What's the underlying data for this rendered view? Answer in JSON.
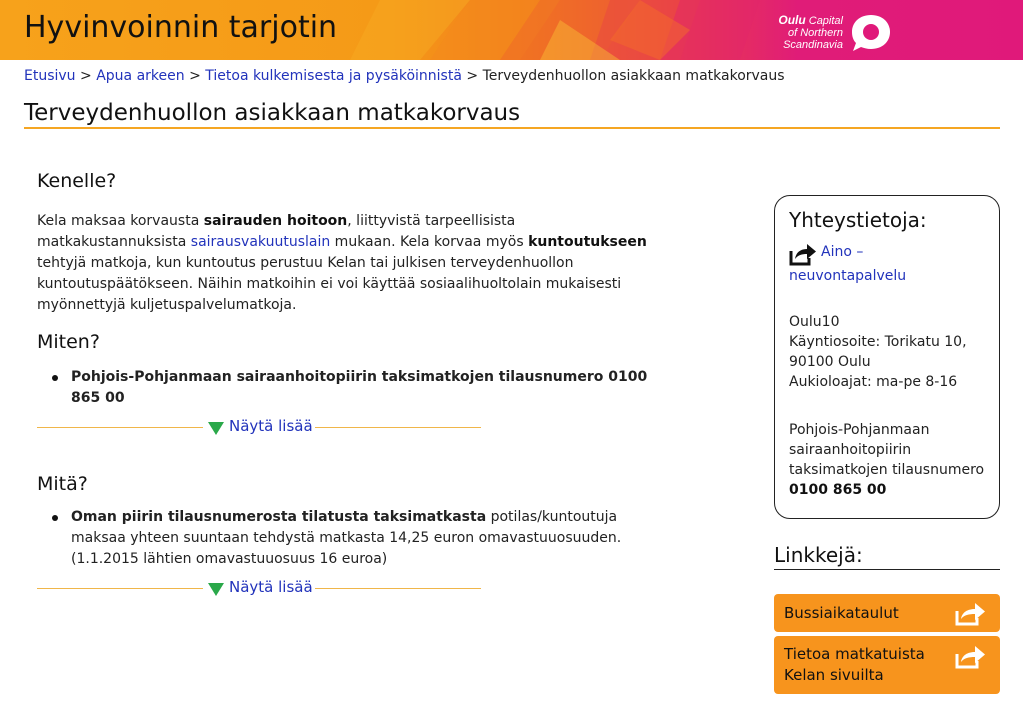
{
  "header": {
    "site_title": "Hyvinvoinnin tarjotin",
    "logo_line1": "Oulu",
    "logo_line1b": "Capital",
    "logo_line2": "of Northern",
    "logo_line3": "Scandinavia"
  },
  "breadcrumb": {
    "items": [
      "Etusivu",
      "Apua arkeen",
      "Tietoa kulkemisesta ja pysäköinnistä"
    ],
    "current": "Terveydenhuollon asiakkaan matkakorvaus",
    "separator": ">"
  },
  "page_title": "Terveydenhuollon asiakkaan matkakorvaus",
  "sections": {
    "kenelle": {
      "heading": "Kenelle?",
      "p1": "Kela maksaa korvausta ",
      "p1_bold": "sairauden hoitoon",
      "p2": ", liittyvistä tarpeellisista matkakustannuksista ",
      "p2_link": "sairausvakuutuslain",
      "p3": " mukaan. Kela korvaa myös ",
      "p3_bold": "kuntoutukseen",
      "p4": " tehtyjä matkoja, kun kuntoutus perustuu Kelan tai julkisen terveydenhuollon kuntoutuspäätökseen. Näihin matkoihin ei voi käyttää sosiaalihuoltolain mukaisesti myönnettyjä kuljetuspalvelumatkoja."
    },
    "miten": {
      "heading": "Miten?",
      "bullet": "Pohjois-Pohjanmaan sairaanhoitopiirin taksimatkojen tilausnumero 0100 865 00",
      "more": "Näytä lisää"
    },
    "mita": {
      "heading": "Mitä?",
      "bullet_bold": "Oman piirin tilausnumerosta tilatusta taksimatkasta",
      "bullet_rest": " potilas/kuntoutuja maksaa yhteen suuntaan tehdystä matkasta 14,25 euron omavastuuosuuden. (1.1.2015 lähtien omavastuuosuus 16 euroa)",
      "more": "Näytä lisää"
    }
  },
  "contact": {
    "heading": "Yhteystietoja:",
    "link_line1": "Aino –",
    "link_line2": "neuvontapalvelu",
    "office_name": "Oulu10",
    "address_1": "Käyntiosoite: Torikatu 10,",
    "address_2": "90100 Oulu",
    "hours": "Aukioloajat: ma-pe 8-16",
    "taxi_1": "Pohjois-Pohjanmaan",
    "taxi_2": "sairaanhoitopiirin",
    "taxi_3": "taksimatkojen tilausnumero",
    "taxi_number": "0100 865 00"
  },
  "links": {
    "heading": "Linkkejä:",
    "items": [
      {
        "line1": "Bussiaikataulut",
        "line2": ""
      },
      {
        "line1": "Tietoa matkatuista",
        "line2": "Kelan sivuilta"
      }
    ]
  },
  "colors": {
    "accent_orange": "#f5a623",
    "button_orange": "#f7941d",
    "link_blue": "#2233bb",
    "triangle_green": "#2aa84a",
    "brand_magenta": "#e0197a"
  },
  "icons": {
    "share": "share-arrow-icon",
    "expand": "triangle-down-icon",
    "logo": "speech-bubble-logo-icon"
  }
}
